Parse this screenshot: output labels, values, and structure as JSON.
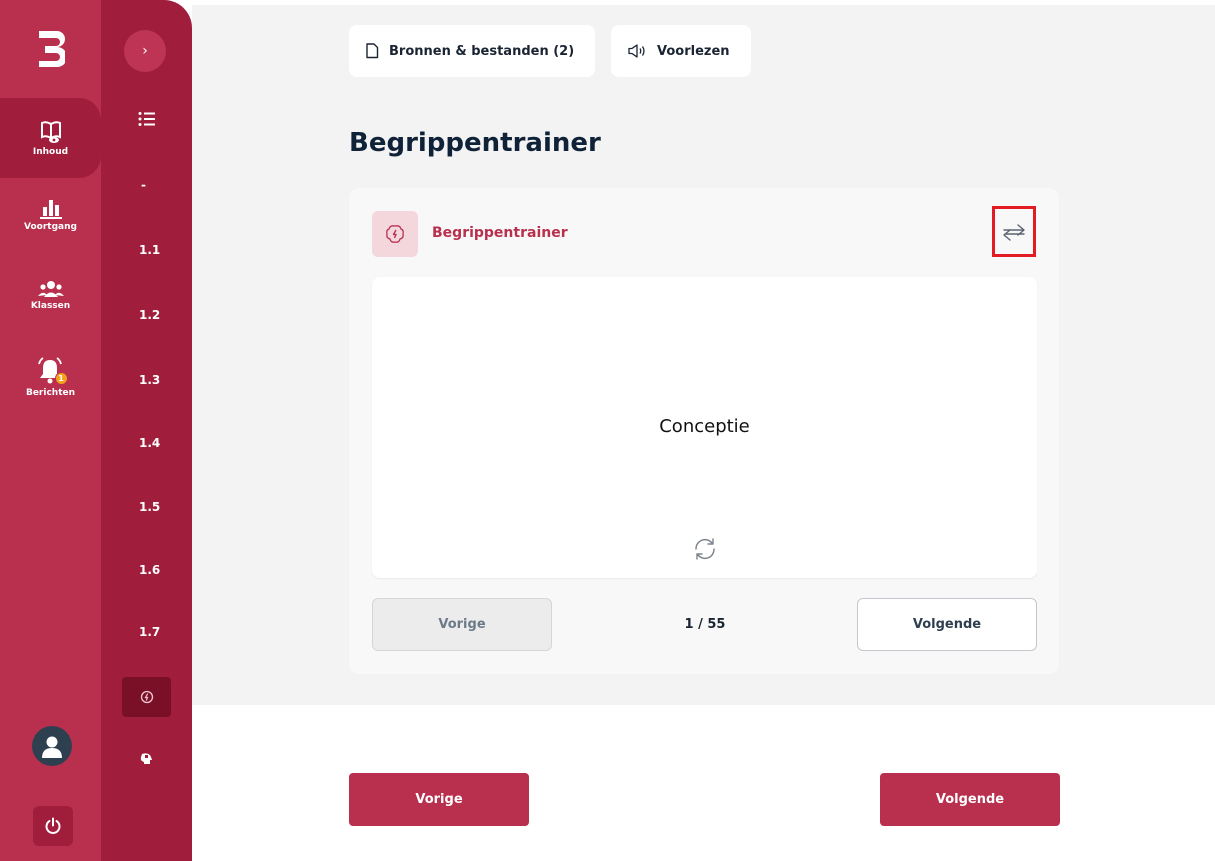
{
  "nav": {
    "items": [
      {
        "label": "Inhoud",
        "icon": "book-icon"
      },
      {
        "label": "Voortgang",
        "icon": "bar-chart-icon"
      },
      {
        "label": "Klassen",
        "icon": "users-icon"
      },
      {
        "label": "Berichten",
        "icon": "bell-icon",
        "badge": "1"
      }
    ]
  },
  "sections": {
    "expand_label": "›",
    "dash": "-",
    "items": [
      "1.1",
      "1.2",
      "1.3",
      "1.4",
      "1.5",
      "1.6",
      "1.7"
    ]
  },
  "toolbar": {
    "sources_label": "Bronnen & bestanden (2)",
    "read_aloud_label": "Voorlezen"
  },
  "page": {
    "title": "Begrippentrainer"
  },
  "trainer": {
    "label": "Begrippentrainer",
    "term": "Conceptie",
    "counter": "1 / 55",
    "prev_label": "Vorige",
    "next_label": "Volgende"
  },
  "footer": {
    "prev_label": "Vorige",
    "next_label": "Volgende"
  },
  "colors": {
    "brand": "#b9304f",
    "brand_dark": "#a01d3c",
    "title": "#0f2238",
    "highlight": "#e31b23"
  }
}
